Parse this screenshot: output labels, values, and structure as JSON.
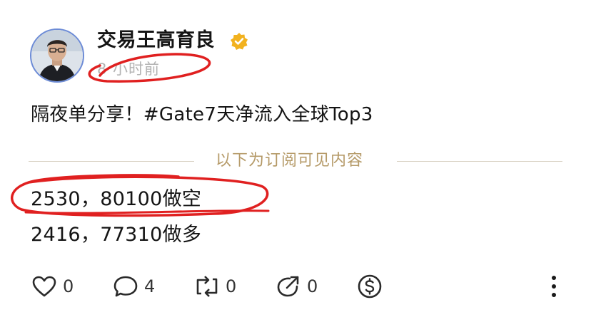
{
  "post": {
    "author_name": "交易王高育良",
    "timestamp": "8 小时前",
    "text": "隔夜单分享！#Gate7天净流入全球Top3",
    "paywall_label": "以下为订阅可见内容",
    "lines": [
      "2530，80100做空",
      "2416，77310做多"
    ]
  },
  "actions": {
    "like_count": "0",
    "comment_count": "4",
    "repost_count": "0",
    "share_count": "0"
  },
  "icons": {
    "verified": "verified-badge-icon",
    "like": "heart-icon",
    "comment": "comment-bubble-icon",
    "repost": "repost-icon",
    "share": "share-icon",
    "tip": "dollar-icon",
    "more": "more-vertical-icon"
  },
  "colors": {
    "verified_badge": "#f2b21f",
    "paywall_label": "#b59a68",
    "timestamp": "#b3b3b3",
    "annotation_red": "#e02020",
    "avatar_ring": "#6c8bd6"
  }
}
